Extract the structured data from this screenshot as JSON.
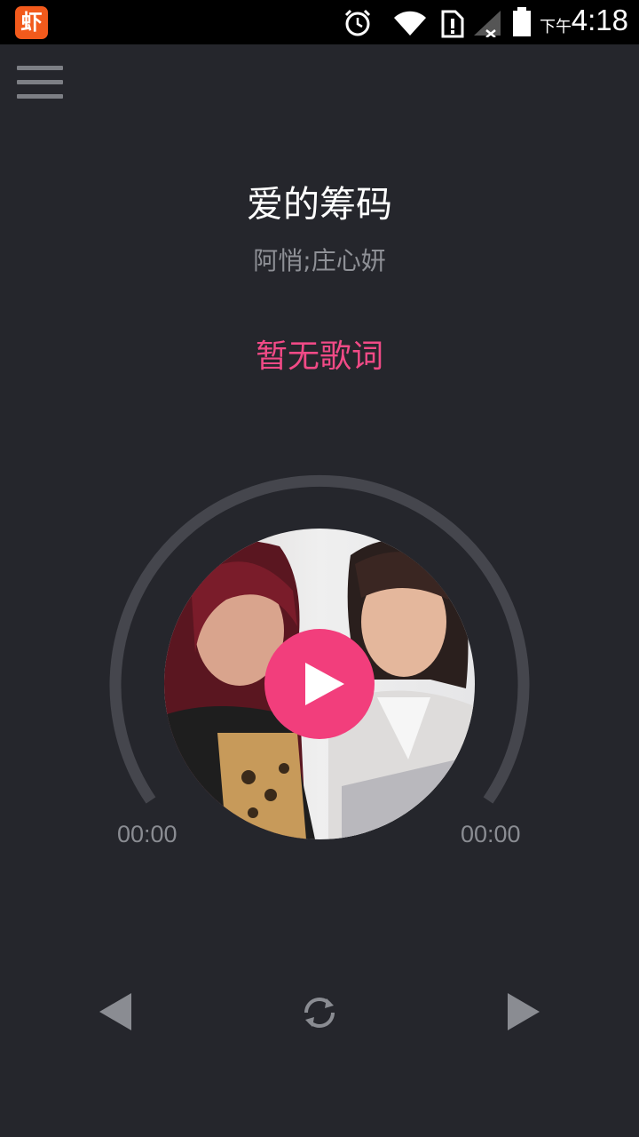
{
  "status_bar": {
    "app_badge": "虾",
    "ampm": "下午",
    "time": "4:18"
  },
  "song": {
    "title": "爱的筹码",
    "artist": "阿悄;庄心妍",
    "lyrics_placeholder": "暂无歌词"
  },
  "player": {
    "current_time": "00:00",
    "total_time": "00:00",
    "progress": 0,
    "state": "paused"
  },
  "colors": {
    "background": "#25262c",
    "accent": "#f23e7c",
    "lyrics": "#f04a86",
    "muted": "#8a8c92"
  },
  "icons": {
    "menu": "hamburger-icon",
    "play": "play-icon",
    "prev": "previous-icon",
    "next": "next-icon",
    "repeat": "repeat-icon"
  }
}
